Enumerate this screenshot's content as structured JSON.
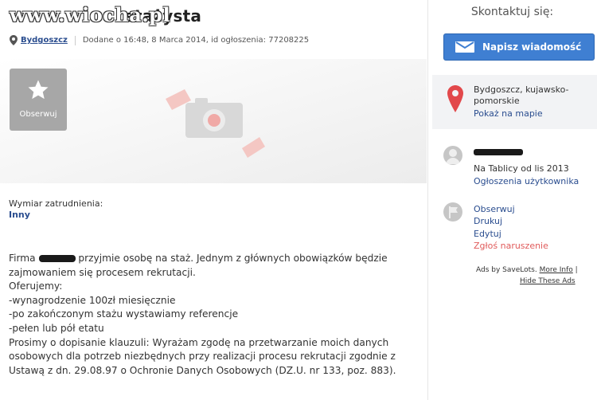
{
  "watermark": {
    "text": "www.wiocha.pl"
  },
  "listing": {
    "title_suffix": "stażysta",
    "city": "Bydgoszcz",
    "meta": "Dodane o 16:48, 8 Marca 2014, id ogłoszenia: 77208225",
    "observe_label": "Obserwuj",
    "field_label": "Wymiar zatrudnienia:",
    "field_value": "Inny",
    "description": {
      "line1_prefix": "Firma",
      "line1_suffix": "przyjmie osobę na staż. Jednym z głównych obowiązków będzie",
      "lines": [
        "zajmowaniem się procesem rekrutacji.",
        "Oferujemy:",
        "-wynagrodzenie 100zł miesięcznie",
        "-po zakończonym stażu wystawiamy referencje",
        "-pełen lub pół etatu",
        "Prosimy o dopisanie klauzuli: Wyrażam zgodę na przetwarzanie moich danych",
        "osobowych dla potrzeb niezbędnych przy realizacji procesu rekrutacji zgodnie z",
        "Ustawą z dn. 29.08.97 o Ochronie Danych Osobowych (DZ.U. nr 133, poz. 883)."
      ]
    }
  },
  "sidebar": {
    "contact_title": "Skontaktuj się:",
    "message_button": "Napisz wiadomość",
    "location": {
      "line1": "Bydgoszcz, kujawsko-",
      "line2": "pomorskie",
      "map_link": "Pokaż na mapie"
    },
    "user": {
      "since": "Na Tablicy od lis 2013",
      "ads_link": "Ogłoszenia użytkownika"
    },
    "actions": {
      "observe": "Obserwuj",
      "print": "Drukuj",
      "edit": "Edytuj",
      "report": "Zgłoś naruszenie"
    },
    "ads": {
      "by": "Ads by SaveLots.",
      "more_info": "More Info",
      "hide": "Hide These Ads"
    }
  },
  "colors": {
    "accent": "#3f7fd2",
    "link": "#2a4d8f",
    "report": "#e05a5a",
    "pin": "#e2484b"
  }
}
